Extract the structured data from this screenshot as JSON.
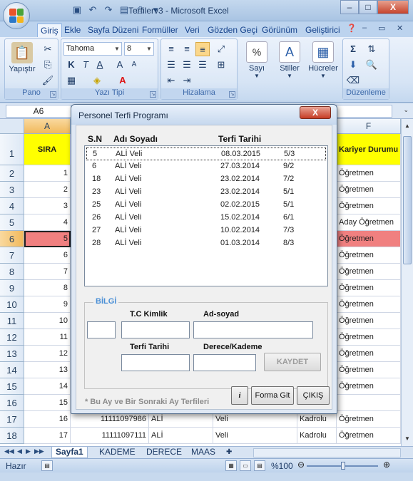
{
  "window": {
    "title": "Terfilerv3 - Microsoft Excel",
    "minimize": "–",
    "maximize": "□",
    "close": "X"
  },
  "ribbon_tabs": [
    "Giriş",
    "Ekle",
    "Sayfa Düzeni",
    "Formüller",
    "Veri",
    "Gözden Geçi",
    "Görünüm",
    "Geliştirici"
  ],
  "ribbon": {
    "paste_label": "Yapıştır",
    "font_name": "Tahoma",
    "font_size": "8",
    "bold": "K",
    "italic": "T",
    "underline": "A",
    "number_label": "Sayı",
    "styles_label": "Stiller",
    "cells_label": "Hücreler",
    "groups": [
      "Pano",
      "Yazı Tipi",
      "Hizalama",
      "Düzenleme"
    ]
  },
  "formula_bar": {
    "name_box": "A6"
  },
  "grid": {
    "columns": [
      "A",
      "F"
    ],
    "header_row": {
      "a": "SIRA",
      "f": "Kariyer Durumu"
    },
    "rows": [
      {
        "num": "2",
        "a": "1",
        "f": "Öğretmen"
      },
      {
        "num": "3",
        "a": "2",
        "f": "Öğretmen"
      },
      {
        "num": "4",
        "a": "3",
        "f": "Öğretmen"
      },
      {
        "num": "5",
        "a": "4",
        "f": "Aday Öğretmen"
      },
      {
        "num": "6",
        "a": "5",
        "f": "Öğretmen"
      },
      {
        "num": "7",
        "a": "6",
        "f": "Öğretmen"
      },
      {
        "num": "8",
        "a": "7",
        "f": "Öğretmen"
      },
      {
        "num": "9",
        "a": "8",
        "f": "Öğretmen"
      },
      {
        "num": "10",
        "a": "9",
        "f": "Öğretmen"
      },
      {
        "num": "11",
        "a": "10",
        "f": "Öğretmen"
      },
      {
        "num": "12",
        "a": "11",
        "f": "Öğretmen"
      },
      {
        "num": "13",
        "a": "12",
        "f": "Öğretmen"
      },
      {
        "num": "14",
        "a": "13",
        "f": "Öğretmen"
      },
      {
        "num": "15",
        "a": "14",
        "f": "Öğretmen"
      },
      {
        "num": "16",
        "a": "15",
        "f": ""
      },
      {
        "num": "17",
        "a": "16",
        "b": "11111097986",
        "c": "ALİ",
        "d": "Veli",
        "e": "Kadrolu",
        "f": "Öğretmen"
      },
      {
        "num": "18",
        "a": "17",
        "b": "11111097111",
        "c": "ALİ",
        "d": "Veli",
        "e": "Kadrolu",
        "f": "Öğretmen"
      }
    ],
    "row1": "1"
  },
  "sheets": [
    "Sayfa1",
    "KADEME",
    "DERECE",
    "MAAS"
  ],
  "status": {
    "ready": "Hazır",
    "zoom": "%100"
  },
  "dialog": {
    "title": "Personel Terfi Programı",
    "close": "X",
    "headers": {
      "sn": "S.N",
      "name": "Adı Soyadı",
      "date": "Terfi Tarihi"
    },
    "rows": [
      {
        "sn": "5",
        "name": "ALİ Veli",
        "date": "08.03.2015",
        "grade": "5/3"
      },
      {
        "sn": "6",
        "name": "ALİ Veli",
        "date": "27.03.2014",
        "grade": "9/2"
      },
      {
        "sn": "18",
        "name": "ALİ Veli",
        "date": "23.02.2014",
        "grade": "7/2"
      },
      {
        "sn": "23",
        "name": "ALİ Veli",
        "date": "23.02.2014",
        "grade": "5/1"
      },
      {
        "sn": "25",
        "name": "ALİ Veli",
        "date": "02.02.2015",
        "grade": "5/1"
      },
      {
        "sn": "26",
        "name": "ALİ Veli",
        "date": "15.02.2014",
        "grade": "6/1"
      },
      {
        "sn": "27",
        "name": "ALİ Veli",
        "date": "10.02.2014",
        "grade": "7/3"
      },
      {
        "sn": "28",
        "name": "ALİ Veli",
        "date": "01.03.2014",
        "grade": "8/3"
      }
    ],
    "info_legend": "BİLGİ",
    "tc_label": "T.C Kimlik",
    "name_label": "Ad-soyad",
    "date_label": "Terfi Tarihi",
    "grade_label": "Derece/Kademe",
    "save_button": "KAYDET",
    "hint": "* Bu Ay ve Bir Sonraki Ay Terfileri",
    "info_button": "i",
    "goto_button": "Forma Git",
    "exit_button": "ÇIKIŞ"
  }
}
